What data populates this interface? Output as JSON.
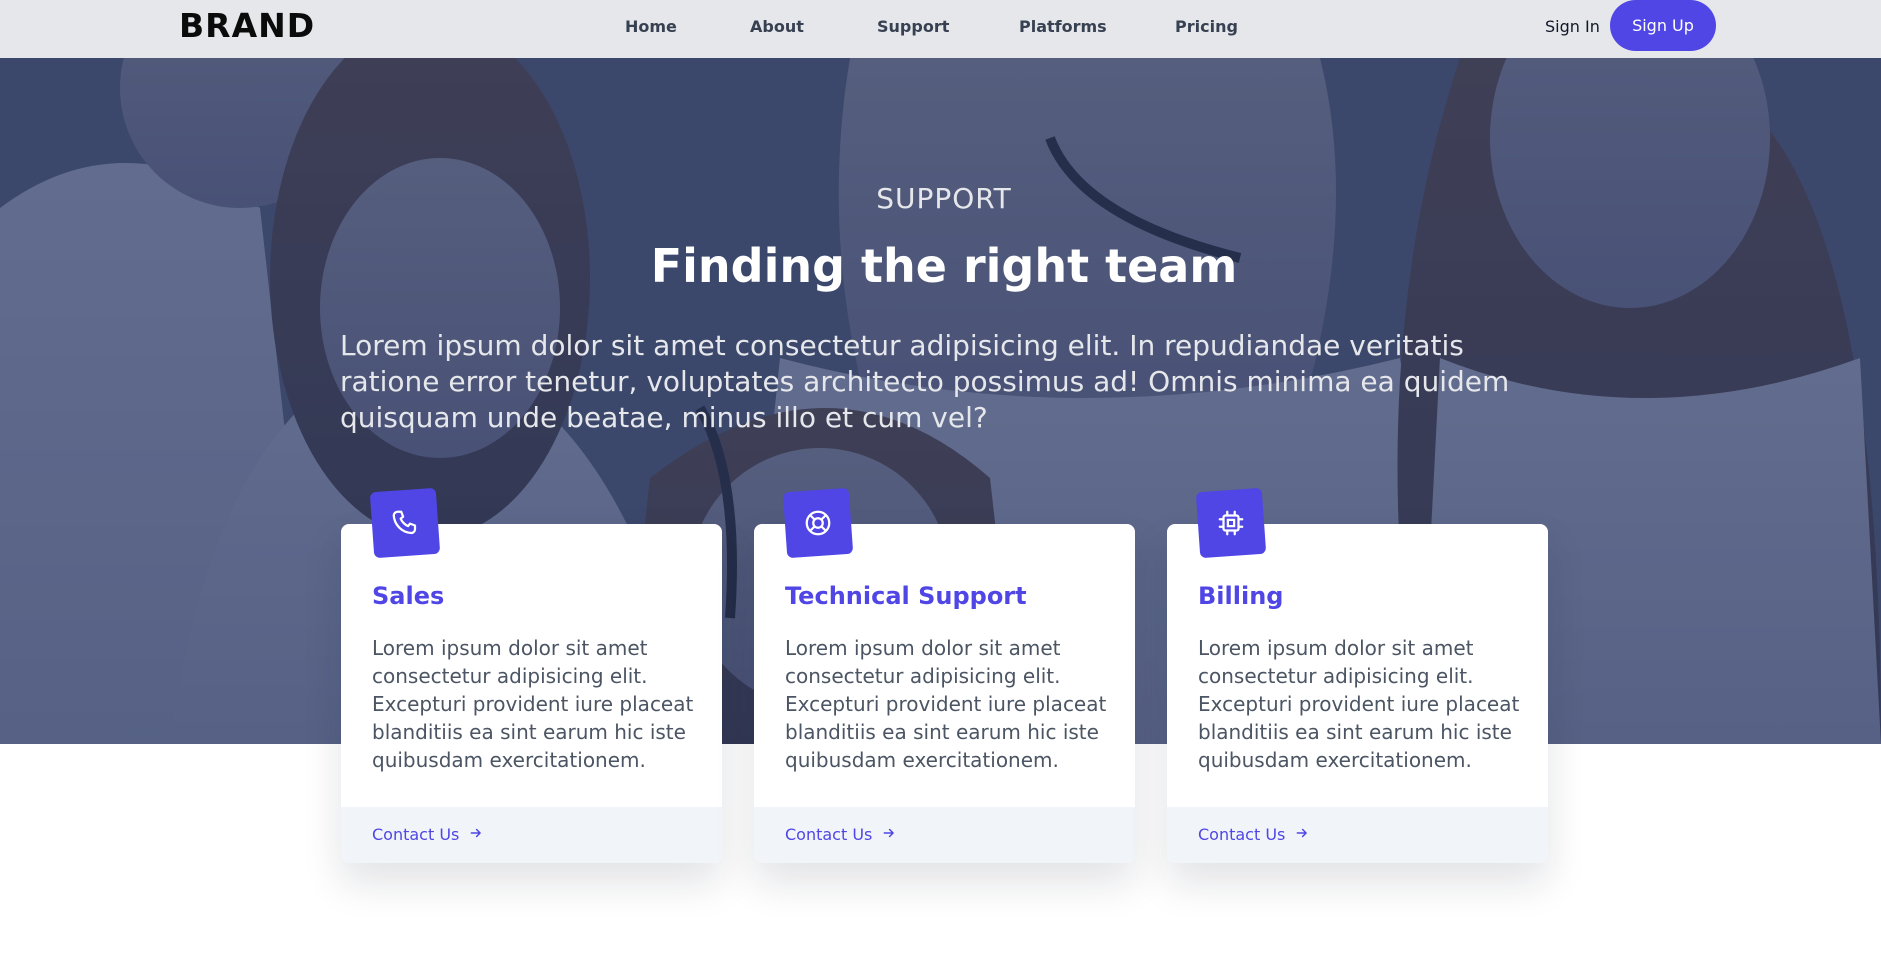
{
  "header": {
    "brand": "BRAND",
    "nav": [
      "Home",
      "About",
      "Support",
      "Platforms",
      "Pricing"
    ],
    "sign_in": "Sign In",
    "sign_up": "Sign Up"
  },
  "hero": {
    "eyebrow": "SUPPORT",
    "title": "Finding the right team",
    "description": "Lorem ipsum dolor sit amet consectetur adipisicing elit. In repudiandae veritatis ratione error tenetur, voluptates architecto possimus ad! Omnis minima ea quidem quisquam unde beatae, minus illo et cum vel?"
  },
  "cards": [
    {
      "icon": "phone-icon",
      "title": "Sales",
      "body": "Lorem ipsum dolor sit amet consectetur adipisicing elit. Excepturi provident iure placeat blanditiis ea sint earum hic iste quibusdam exercitationem.",
      "link": "Contact Us"
    },
    {
      "icon": "lifebuoy-icon",
      "title": "Technical Support",
      "body": "Lorem ipsum dolor sit amet consectetur adipisicing elit. Excepturi provident iure placeat blanditiis ea sint earum hic iste quibusdam exercitationem.",
      "link": "Contact Us"
    },
    {
      "icon": "chip-icon",
      "title": "Billing",
      "body": "Lorem ipsum dolor sit amet consectetur adipisicing elit. Excepturi provident iure placeat blanditiis ea sint earum hic iste quibusdam exercitationem.",
      "link": "Contact Us"
    }
  ],
  "colors": {
    "accent": "#4f46e5",
    "nav_bg": "#e5e7eb",
    "hero_overlay": "#2a3660",
    "footer_bg": "#f1f5f9"
  }
}
